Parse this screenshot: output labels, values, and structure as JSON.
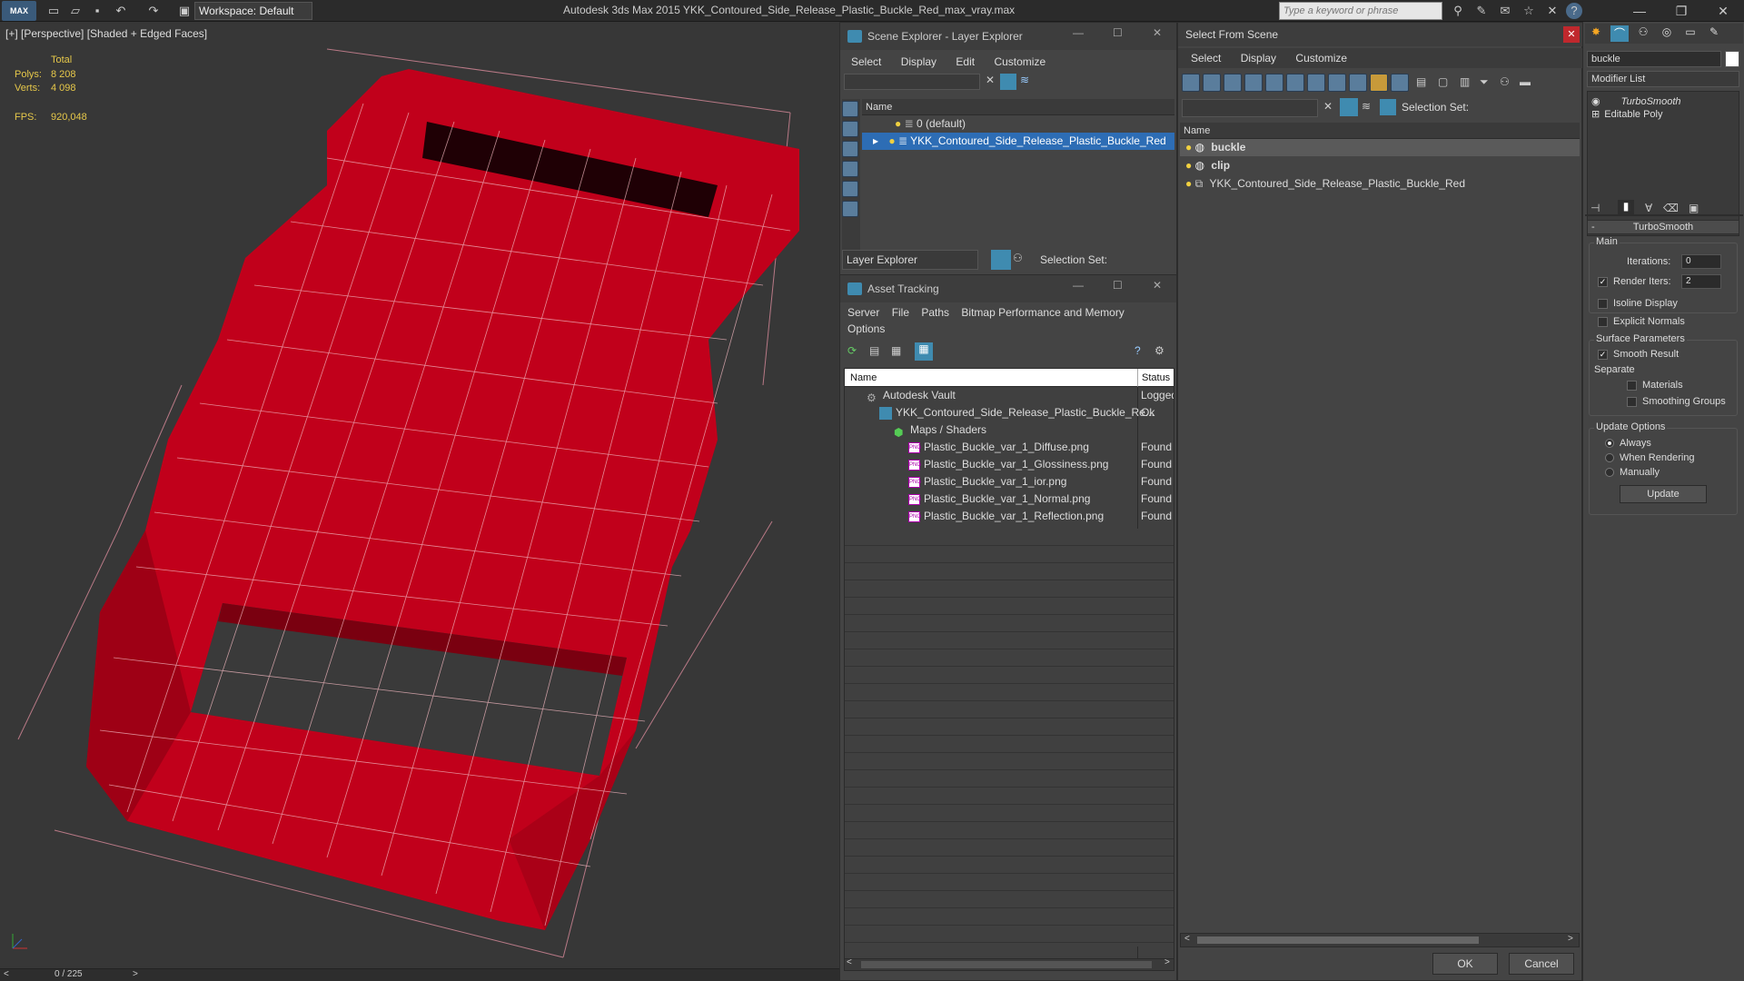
{
  "app": {
    "logo": "MAX",
    "title": "Autodesk 3ds Max  2015     YKK_Contoured_Side_Release_Plastic_Buckle_Red_max_vray.max",
    "workspace": "Workspace: Default",
    "search_placeholder": "Type a keyword or phrase"
  },
  "viewport": {
    "label": "[+] [Perspective] [Shaded + Edged Faces]",
    "stats": {
      "total_label": "Total",
      "polys_label": "Polys:",
      "polys_value": "8 208",
      "verts_label": "Verts:",
      "verts_value": "4 098",
      "fps_label": "FPS:",
      "fps_value": "920,048"
    },
    "timeline": "0 / 225",
    "colors": {
      "mesh": "#c1001b",
      "background": "#373737"
    }
  },
  "scene_explorer": {
    "title": "Scene Explorer - Layer Explorer",
    "menu": [
      "Select",
      "Display",
      "Edit",
      "Customize"
    ],
    "column_name": "Name",
    "rows": [
      "0 (default)",
      "YKK_Contoured_Side_Release_Plastic_Buckle_Red"
    ],
    "footer_dropdown": "Layer Explorer",
    "selection_set_label": "Selection Set:"
  },
  "asset_tracking": {
    "title": "Asset Tracking",
    "menu": [
      "Server",
      "File",
      "Paths",
      "Bitmap Performance and Memory"
    ],
    "menu2": "Options",
    "columns": {
      "name": "Name",
      "status": "Status"
    },
    "rows": [
      {
        "name": "Autodesk Vault",
        "status": "Logged"
      },
      {
        "name": "YKK_Contoured_Side_Release_Plastic_Buckle_Re...",
        "status": "Ok"
      },
      {
        "name": "Maps / Shaders",
        "status": ""
      },
      {
        "name": "Plastic_Buckle_var_1_Diffuse.png",
        "status": "Found"
      },
      {
        "name": "Plastic_Buckle_var_1_Glossiness.png",
        "status": "Found"
      },
      {
        "name": "Plastic_Buckle_var_1_ior.png",
        "status": "Found"
      },
      {
        "name": "Plastic_Buckle_var_1_Normal.png",
        "status": "Found"
      },
      {
        "name": "Plastic_Buckle_var_1_Reflection.png",
        "status": "Found"
      }
    ]
  },
  "select_from_scene": {
    "title": "Select From Scene",
    "menu": [
      "Select",
      "Display",
      "Customize"
    ],
    "selection_set_label": "Selection Set:",
    "column_name": "Name",
    "rows": [
      "buckle",
      "clip",
      "YKK_Contoured_Side_Release_Plastic_Buckle_Red"
    ],
    "ok": "OK",
    "cancel": "Cancel"
  },
  "command_panel": {
    "object_name": "buckle",
    "modifier_list": "Modifier List",
    "stack": [
      "TurboSmooth",
      "Editable Poly"
    ],
    "rollout_title": "TurboSmooth",
    "main_group": "Main",
    "iterations_label": "Iterations:",
    "iterations_value": "0",
    "render_iters_label": "Render Iters:",
    "render_iters_value": "2",
    "isoline": "Isoline Display",
    "explicit_normals": "Explicit Normals",
    "surface_group": "Surface Parameters",
    "smooth_result": "Smooth Result",
    "separate": "Separate",
    "materials": "Materials",
    "smoothing_groups": "Smoothing Groups",
    "update_group": "Update Options",
    "always": "Always",
    "when_rendering": "When Rendering",
    "manually": "Manually",
    "update_button": "Update"
  }
}
